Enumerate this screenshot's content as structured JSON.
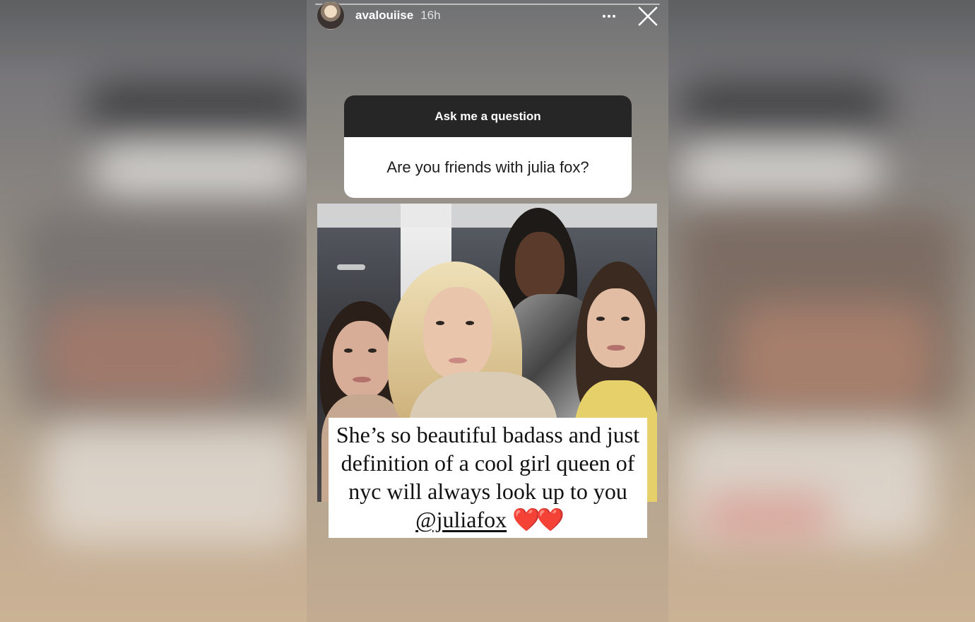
{
  "story": {
    "username": "avalouiise",
    "time": "16h",
    "more_icon": "more-horizontal-icon",
    "close_icon": "close-icon"
  },
  "question_sticker": {
    "prompt": "Ask me a question",
    "question": "Are you friends with julia fox?"
  },
  "caption": {
    "text": "She’s so beautiful badass and just definition of a cool girl queen of nyc will always look up to you ",
    "mention": "@juliafox",
    "emoji": "❤️❤️"
  },
  "colors": {
    "sticker_header": "#262626",
    "heart": "#e0241b"
  }
}
